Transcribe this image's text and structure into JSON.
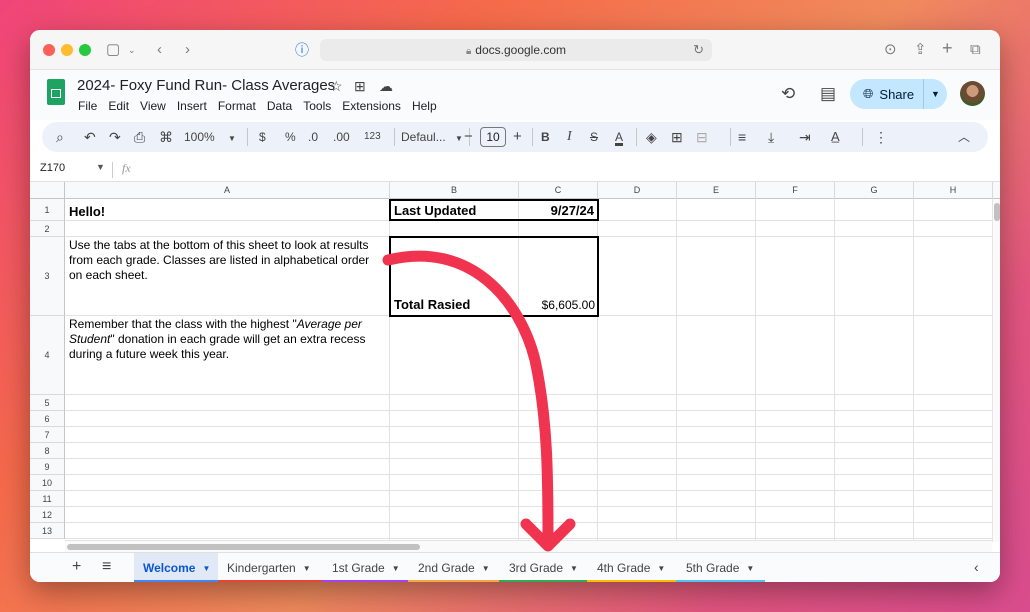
{
  "browser": {
    "url": "docs.google.com"
  },
  "doc": {
    "title": "2024- Foxy Fund Run- Class Averages",
    "menu": [
      "File",
      "Edit",
      "View",
      "Insert",
      "Format",
      "Data",
      "Tools",
      "Extensions",
      "Help"
    ],
    "share_label": "Share"
  },
  "toolbar": {
    "zoom": "100%",
    "currency": "$",
    "percent": "%",
    "decrease_decimal": ".0",
    "increase_decimal": ".00",
    "number_format": "123",
    "font": "Defaul...",
    "font_size": "10",
    "bold": "B",
    "italic": "I",
    "text_color": "A"
  },
  "formula_bar": {
    "name_box": "Z170",
    "fx": "fx"
  },
  "grid": {
    "columns": [
      "A",
      "B",
      "C",
      "D",
      "E",
      "F",
      "G",
      "H"
    ],
    "rows": [
      "1",
      "2",
      "3",
      "4",
      "5",
      "6",
      "7",
      "8",
      "9",
      "10",
      "11",
      "12",
      "13"
    ],
    "a1": "Hello!",
    "a3_line1": "Use the tabs at the bottom of this sheet to look at results",
    "a3_line2": "from each grade. Classes are listed in alphabetical order",
    "a3_line3": "on each sheet.",
    "a4_part1": "Remember that the class with the highest \"",
    "a4_italic": "Average per",
    "a4_italic2": "Student",
    "a4_part2": "\" donation in each grade will get an extra recess",
    "a4_line3": "during a future week this year.",
    "last_updated_label": "Last Updated",
    "last_updated_value": "9/27/24",
    "total_label": "Total Rasied",
    "total_value": "$6,605.00"
  },
  "sheet_tabs": [
    {
      "label": "Welcome",
      "color": "#4285f4",
      "active": true
    },
    {
      "label": "Kindergarten",
      "color": "#ea4335",
      "active": false
    },
    {
      "label": "1st Grade",
      "color": "#a142f4",
      "active": false
    },
    {
      "label": "2nd Grade",
      "color": "#f4a742",
      "active": false
    },
    {
      "label": "3rd Grade",
      "color": "#34a853",
      "active": false
    },
    {
      "label": "4th Grade",
      "color": "#fbbc04",
      "active": false
    },
    {
      "label": "5th Grade",
      "color": "#4fc3f7",
      "active": false
    }
  ],
  "colors": {
    "annotation_arrow": "#f0344f",
    "share_bg": "#c2e7ff",
    "sheets_green": "#1ea362"
  }
}
